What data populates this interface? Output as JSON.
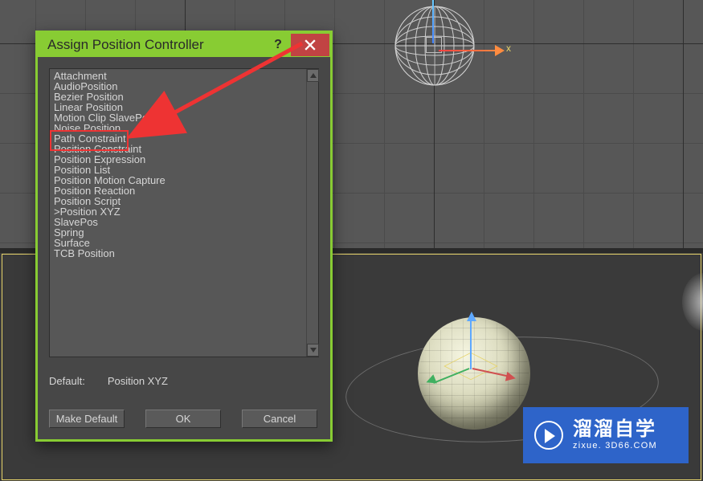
{
  "dialog": {
    "title": "Assign Position Controller",
    "help_icon": "?",
    "listbox": {
      "items": [
        "Attachment",
        "AudioPosition",
        "Bezier Position",
        "Linear Position",
        "Motion Clip SlavePos",
        "Noise Position",
        "Path Constraint",
        "Position Constraint",
        "Position Expression",
        "Position List",
        "Position Motion Capture",
        "Position Reaction",
        "Position Script",
        ">Position XYZ",
        "SlavePos",
        "Spring",
        "Surface",
        "TCB Position"
      ]
    },
    "default_label": "Default:",
    "default_value": "Position XYZ",
    "buttons": {
      "make_default": "Make Default",
      "ok": "OK",
      "cancel": "Cancel"
    }
  },
  "gizmo": {
    "x_label": "x"
  },
  "watermark": {
    "text_cn": "溜溜自学",
    "text_url": "zixue. 3D66.COM"
  },
  "annotation": {
    "highlighted_item": "Path Constraint"
  }
}
